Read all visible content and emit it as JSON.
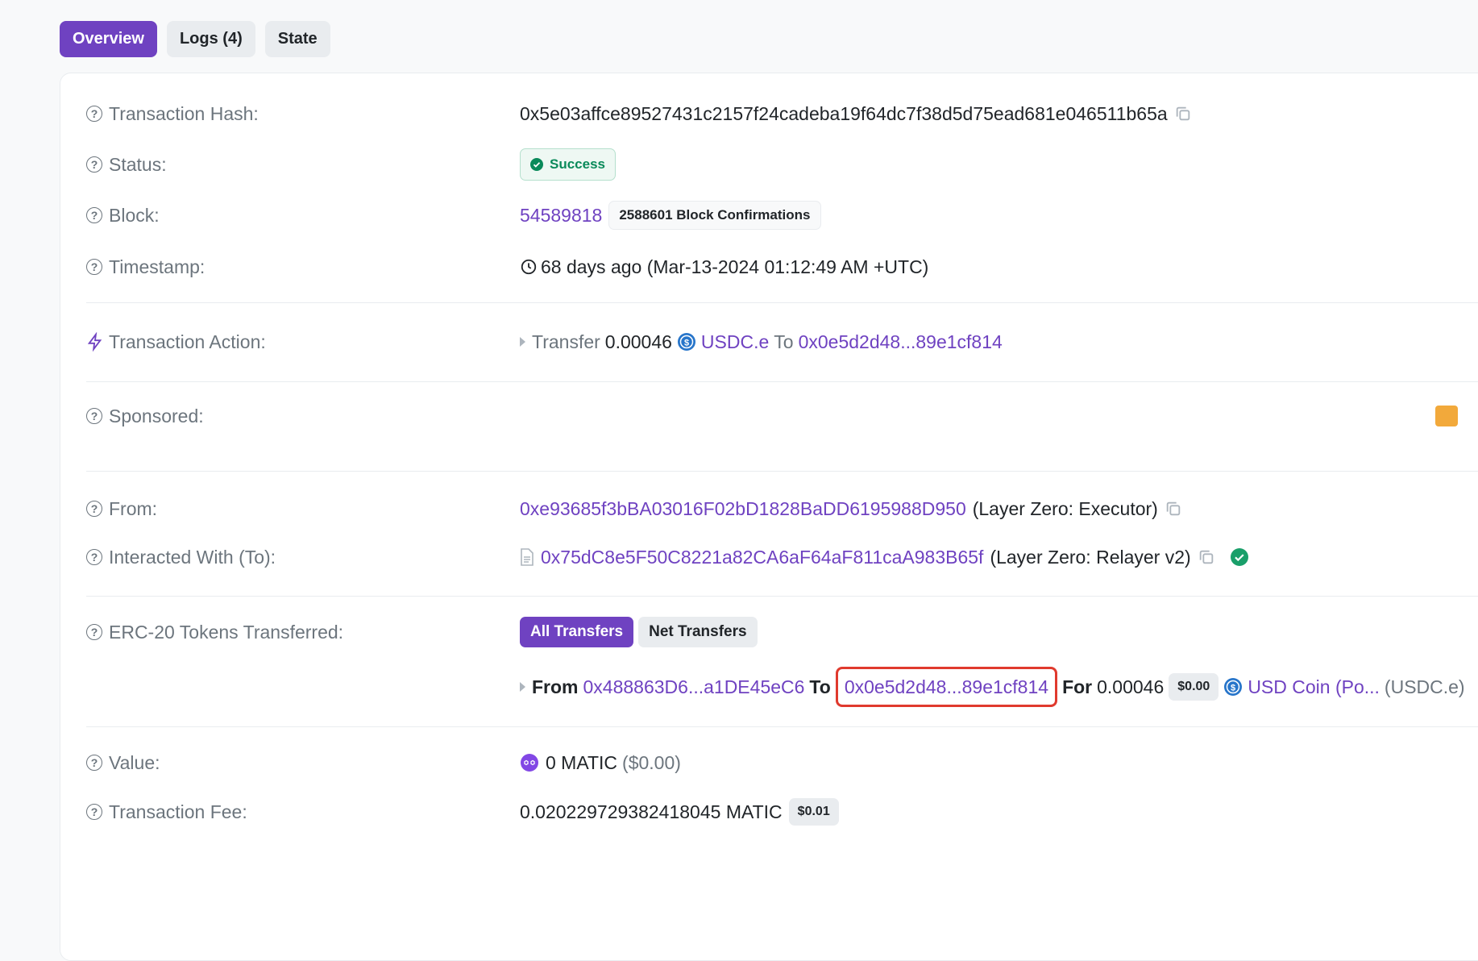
{
  "tabs": [
    {
      "label": "Overview",
      "active": true
    },
    {
      "label": "Logs (4)",
      "active": false
    },
    {
      "label": "State",
      "active": false
    }
  ],
  "tx": {
    "hash_label": "Transaction Hash:",
    "hash": "0x5e03affce89527431c2157f24cadeba19f64dc7f38d5d75ead681e046511b65a",
    "status_label": "Status:",
    "status": "Success",
    "block_label": "Block:",
    "block": "54589818",
    "confirmations": "2588601 Block Confirmations",
    "timestamp_label": "Timestamp:",
    "timestamp": "68 days ago (Mar-13-2024 01:12:49 AM +UTC)",
    "action_label": "Transaction Action:",
    "action_word": "Transfer",
    "action_amount": "0.00046",
    "action_token": "USDC.e",
    "action_to_word": "To",
    "action_to": "0x0e5d2d48...89e1cf814",
    "sponsored_label": "Sponsored:",
    "from_label": "From:",
    "from": "0xe93685f3bBA03016F02bD1828BaDD6195988D950",
    "from_name": "(Layer Zero: Executor)",
    "to_label": "Interacted With (To):",
    "to": "0x75dC8e5F50C8221a82CA6aF64aF811caA983B65f",
    "to_name": "(Layer Zero: Relayer v2)",
    "erc20_label": "ERC-20 Tokens Transferred:",
    "all_transfers": "All Transfers",
    "net_transfers": "Net Transfers",
    "t_from_word": "From",
    "t_from": "0x488863D6...a1DE45eC6",
    "t_to_word": "To",
    "t_to": "0x0e5d2d48...89e1cf814",
    "t_for_word": "For",
    "t_amount": "0.00046",
    "t_usd": "$0.00",
    "t_token": "USD Coin (Po...",
    "t_symbol": "(USDC.e)",
    "value_label": "Value:",
    "value": "0 MATIC",
    "value_usd": "($0.00)",
    "fee_label": "Transaction Fee:",
    "fee": "0.020229729382418045 MATIC",
    "fee_usd": "$0.01"
  },
  "colors": {
    "accent": "#6f42c1",
    "success": "#0a8a5a",
    "highlight": "#e03a2e"
  }
}
